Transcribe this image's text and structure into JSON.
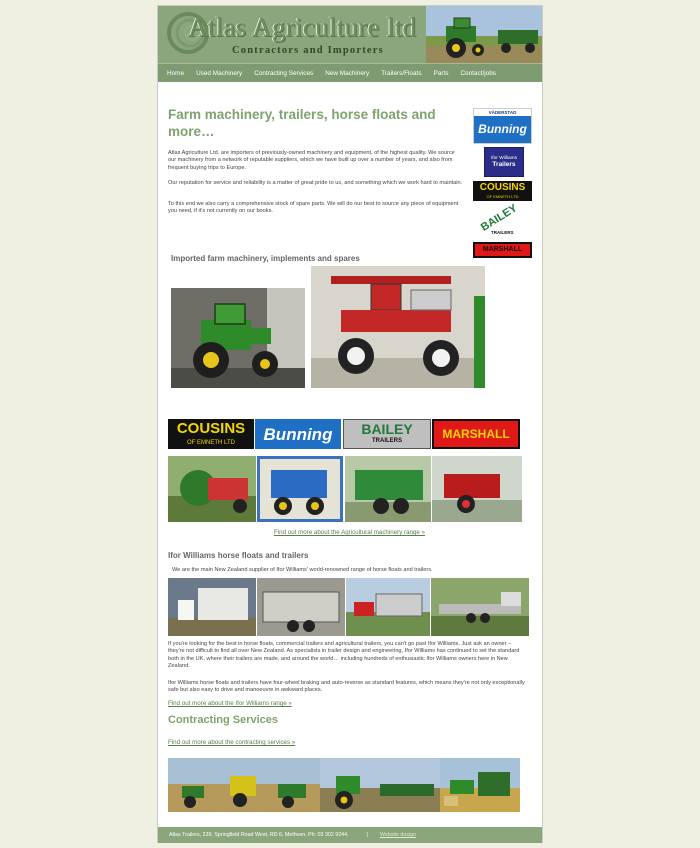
{
  "site": {
    "title": "Atlas Agriculture ltd",
    "subtitle": "Contractors and Importers"
  },
  "nav": {
    "items": [
      "Home",
      "Used Machinery",
      "Contracting Services",
      "New Machinery",
      "Trailers/Floats",
      "Parts",
      "Contact/jobs"
    ]
  },
  "intro": {
    "heading": "Farm machinery, trailers, horse floats and more…",
    "p1": "Atlas Agriculture Ltd. are importers of previously-owned machinery and equipment, of the highest quality. We source our machinery from a network of reputable suppliers, which we have built up over a number of years, and also from frequent buying trips to Europe.",
    "p2": "Our reputation for service and reliability is a matter of great pride to us, and something which we work hard to maintain.",
    "p3": "To this end we also carry a comprehensive stock of spare parts. We will do our best to source any piece of equipment you need, if it's not currently on our books."
  },
  "sidebar_logos": {
    "vaderstad": "VÄDERSTAD",
    "bunning": "Bunning",
    "ifor_line1": "Ifor Williams",
    "ifor_line2": "Trailers",
    "cousins": "COUSINS",
    "cousins_sub": "OF EMNETH LTD",
    "bailey": "BAILEY",
    "bailey_sub": "TRAILERS",
    "marshall": "MARSHALL"
  },
  "imported": {
    "heading": "Imported farm machinery, implements and spares"
  },
  "brand_strip": {
    "cousins": "COUSINS",
    "cousins_sub": "OF EMNETH LTD",
    "bunning": "Bunning",
    "bailey": "BAILEY",
    "bailey_sub": "TRAILERS",
    "marshall": "MARSHALL"
  },
  "links": {
    "agri": "Find out more about the Agricultural machinery range »",
    "ifor": "Find out more about the Ifor Williams range »",
    "contracting": "Find out more about the contracting services »"
  },
  "ifor": {
    "heading": "Ifor Williams horse floats and trailers",
    "intro": "We are the main New Zealand supplier of Ifor Williams' world-renowned range of horse floats and trailers.",
    "p1": "If you're looking for the best in horse floats, commercial trailers and agricultural trailers, you can't go past Ifor Williams.  Just ask an owner – they're not difficult to find all over New Zealand. As specialists in trailer design and engineering, Ifor Williams has continued to set the standard both in the UK, where their trailers are made, and around the world… including hundreds of enthusiastic Ifor Williams owners here in New Zealand.",
    "p2": "Ifor Williams horse floats and trailers have four-wheel braking and auto-reverse as standard features, which means they're not only exceptionally safe but also easy to drive and manoeuvre in awkward places."
  },
  "contracting": {
    "heading": "Contracting Services"
  },
  "footer": {
    "address": "Atlas Trailers, 239, Springfield Road West, RD 6, Methven. Ph: 03 302 9244.",
    "separator": "|",
    "design_link": "Website design"
  },
  "colors": {
    "header_green": "#8ba67c",
    "heading_green": "#7fa36e",
    "bunning_blue": "#1f6fc4",
    "cousins_yellow": "#f4d700",
    "marshall_red": "#e01818"
  }
}
